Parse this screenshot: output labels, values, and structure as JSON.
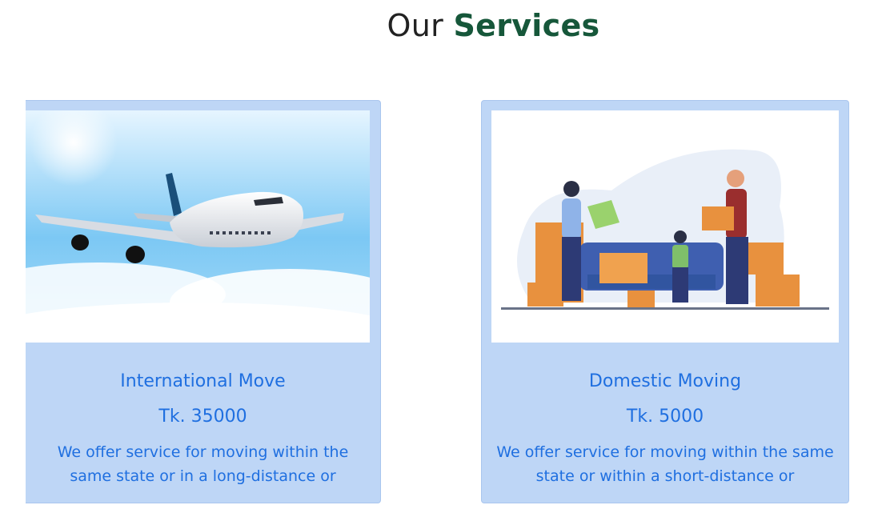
{
  "header": {
    "title_prefix": "Our",
    "title_accent": "Services"
  },
  "services": [
    {
      "title": "International Move",
      "price": "Tk. 35000",
      "description": "We offer service for moving within the same state or in a long-distance or",
      "image": "airplane-in-sky-illustration"
    },
    {
      "title": "Domestic Moving",
      "price": "Tk. 5000",
      "description": "We offer service for moving within the same state or within a short-distance or",
      "image": "family-packing-boxes-illustration"
    }
  ],
  "colors": {
    "card_bg": "#bed6f6",
    "card_text": "#1f6fe0",
    "title_accent": "#16573a"
  }
}
